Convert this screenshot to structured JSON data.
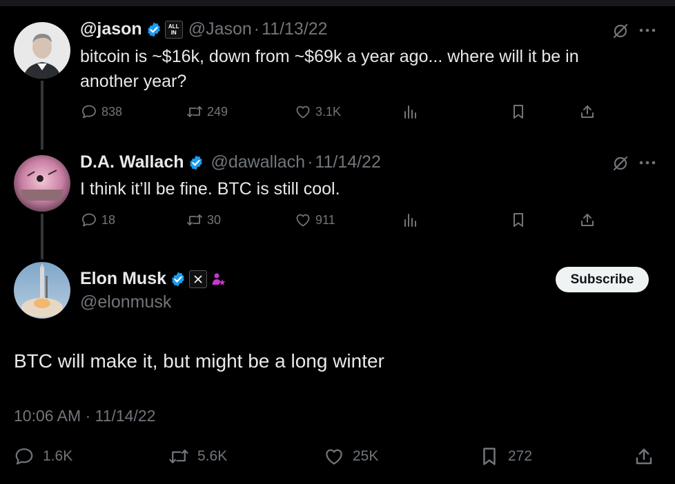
{
  "colors": {
    "background": "#000000",
    "text": "#e7e9ea",
    "muted": "#71767b",
    "verified": "#1d9bf0",
    "subscribe_bg": "#eff3f4",
    "affiliate_pink": "#c936cc"
  },
  "tweets": [
    {
      "name": "@jason",
      "badge_text": "ALL IN",
      "handle": "@Jason",
      "date": "11/13/22",
      "text": "bitcoin is ~$16k, down from ~$69k a year ago... where will it be in another year?",
      "replies": "838",
      "retweets": "249",
      "likes": "3.1K"
    },
    {
      "name": "D.A. Wallach",
      "handle": "@dawallach",
      "date": "11/14/22",
      "text": "I think it’ll be fine. BTC is still cool.",
      "replies": "18",
      "retweets": "30",
      "likes": "911"
    }
  ],
  "main_tweet": {
    "name": "Elon Musk",
    "handle": "@elonmusk",
    "subscribe_label": "Subscribe",
    "text": "BTC will make it, but might be a long winter",
    "timestamp": "10:06 AM · 11/14/22",
    "replies": "1.6K",
    "retweets": "5.6K",
    "likes": "25K",
    "bookmarks": "272"
  },
  "separator": "·",
  "icons": [
    "verified-badge-icon",
    "affiliate-badge-icon",
    "x-logo-icon",
    "grok-slash-icon",
    "more-icon",
    "reply-icon",
    "retweet-icon",
    "like-icon",
    "views-icon",
    "bookmark-icon",
    "share-icon"
  ]
}
